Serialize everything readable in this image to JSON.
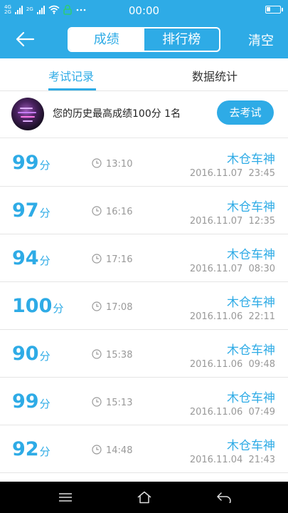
{
  "status_bar": {
    "network_top": "4G",
    "network_bottom": "2G",
    "network2_top": "2G",
    "time": "00:00"
  },
  "header": {
    "tabs": [
      {
        "label": "成绩",
        "active": true
      },
      {
        "label": "排行榜",
        "active": false
      }
    ],
    "clear_label": "清空"
  },
  "subtabs": [
    {
      "label": "考试记录",
      "active": true
    },
    {
      "label": "数据统计",
      "active": false
    }
  ],
  "best": {
    "text": "您的历史最高成绩100分  1名",
    "button_label": "去考试"
  },
  "records": [
    {
      "score": "99",
      "unit": "分",
      "duration": "13:10",
      "name": "木仓车神",
      "date": "2016.11.07  23:45"
    },
    {
      "score": "97",
      "unit": "分",
      "duration": "16:16",
      "name": "木仓车神",
      "date": "2016.11.07  12:35"
    },
    {
      "score": "94",
      "unit": "分",
      "duration": "17:16",
      "name": "木仓车神",
      "date": "2016.11.07  08:30"
    },
    {
      "score": "100",
      "unit": "分",
      "duration": "17:08",
      "name": "木仓车神",
      "date": "2016.11.06  22:11"
    },
    {
      "score": "90",
      "unit": "分",
      "duration": "15:38",
      "name": "木仓车神",
      "date": "2016.11.06  09:48"
    },
    {
      "score": "99",
      "unit": "分",
      "duration": "15:13",
      "name": "木仓车神",
      "date": "2016.11.06  07:49"
    },
    {
      "score": "92",
      "unit": "分",
      "duration": "14:48",
      "name": "木仓车神",
      "date": "2016.11.04  21:43"
    }
  ],
  "colors": {
    "accent": "#2eabe6",
    "muted_text": "#999999",
    "nav_bar": "#000000"
  },
  "icons": {
    "back": "arrow-left-icon",
    "clock": "clock-icon",
    "nav_menu": "menu-icon",
    "nav_home": "home-icon",
    "nav_back": "back-icon"
  }
}
